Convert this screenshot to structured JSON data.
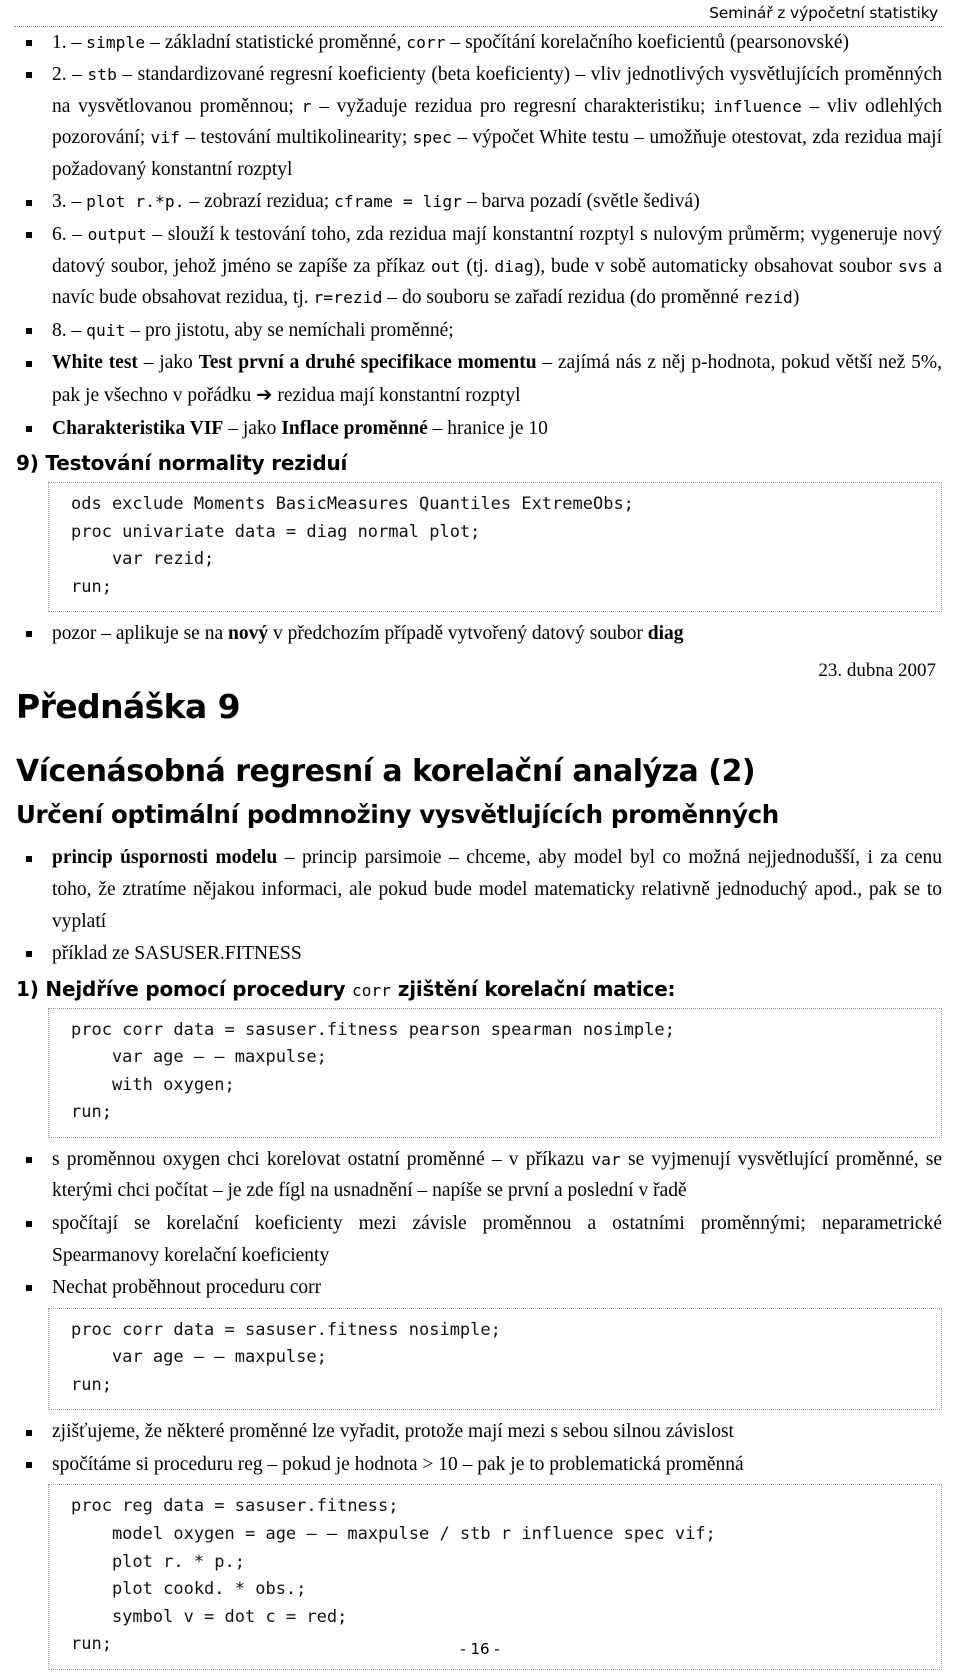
{
  "header": {
    "title": "Seminář z výpočetní statistiky"
  },
  "bullets_top": [
    {
      "id": "item-1-simple",
      "parts": [
        {
          "t": "1. – ",
          "s": "plain"
        },
        {
          "t": "simple",
          "s": "mono"
        },
        {
          "t": " – základní statistické proměnné, ",
          "s": "plain"
        },
        {
          "t": "corr",
          "s": "mono"
        },
        {
          "t": " – spočítání korelačního koeficientů (pearsonovské)",
          "s": "plain"
        }
      ]
    },
    {
      "id": "item-2-stb",
      "parts": [
        {
          "t": "2. – ",
          "s": "plain"
        },
        {
          "t": "stb",
          "s": "mono"
        },
        {
          "t": " – standardizované regresní koeficienty (beta koeficienty) – vliv jednotlivých vysvětlujících proměnných na vysvětlovanou proměnnou; ",
          "s": "plain"
        },
        {
          "t": "r",
          "s": "mono"
        },
        {
          "t": " – vyžaduje rezidua pro regresní charakteristiku; ",
          "s": "plain"
        },
        {
          "t": "influence",
          "s": "mono"
        },
        {
          "t": " – vliv odlehlých pozorování; ",
          "s": "plain"
        },
        {
          "t": "vif",
          "s": "mono"
        },
        {
          "t": " – testování multikolinearity; ",
          "s": "plain"
        },
        {
          "t": "spec",
          "s": "mono"
        },
        {
          "t": " – výpočet White testu – umožňuje otestovat, zda rezidua mají požadovaný konstantní rozptyl",
          "s": "plain"
        }
      ]
    },
    {
      "id": "item-3-plot",
      "parts": [
        {
          "t": "3. – ",
          "s": "plain"
        },
        {
          "t": "plot r.*p.",
          "s": "mono"
        },
        {
          "t": " – zobrazí rezidua; ",
          "s": "plain"
        },
        {
          "t": "cframe = ligr",
          "s": "mono"
        },
        {
          "t": " – barva pozadí (světle šedivá)",
          "s": "plain"
        }
      ]
    },
    {
      "id": "item-6-output",
      "parts": [
        {
          "t": "6. – ",
          "s": "plain"
        },
        {
          "t": "output",
          "s": "mono"
        },
        {
          "t": " – slouží k testování toho, zda rezidua mají konstantní rozptyl s nulovým průměrm; vygeneruje nový datový soubor, jehož jméno se zapíše za příkaz ",
          "s": "plain"
        },
        {
          "t": "out",
          "s": "mono"
        },
        {
          "t": " (tj. ",
          "s": "plain"
        },
        {
          "t": "diag",
          "s": "mono"
        },
        {
          "t": "), bude v sobě automaticky obsahovat soubor ",
          "s": "plain"
        },
        {
          "t": "svs",
          "s": "mono"
        },
        {
          "t": " a navíc bude obsahovat rezidua, tj. ",
          "s": "plain"
        },
        {
          "t": "r=rezid",
          "s": "mono"
        },
        {
          "t": " – do souboru se zařadí rezidua (do proměnné ",
          "s": "plain"
        },
        {
          "t": "rezid",
          "s": "mono"
        },
        {
          "t": ")",
          "s": "plain"
        }
      ]
    },
    {
      "id": "item-8-quit",
      "parts": [
        {
          "t": "8. – ",
          "s": "plain"
        },
        {
          "t": "quit",
          "s": "mono"
        },
        {
          "t": " – pro jistotu, aby se nemíchali proměnné;",
          "s": "plain"
        }
      ]
    },
    {
      "id": "item-white-test",
      "parts": [
        {
          "t": "White test",
          "s": "bold"
        },
        {
          "t": " – jako ",
          "s": "plain"
        },
        {
          "t": "Test první a druhé specifikace momentu",
          "s": "bold"
        },
        {
          "t": " – zajímá nás z něj p-hodnota, pokud větší než 5%, pak je všechno v pořádku ",
          "s": "plain"
        },
        {
          "t": "➔",
          "s": "arrow"
        },
        {
          "t": " rezidua mají konstantní rozptyl",
          "s": "plain"
        }
      ]
    },
    {
      "id": "item-vif",
      "parts": [
        {
          "t": "Charakteristika VIF",
          "s": "bold"
        },
        {
          "t": " – jako ",
          "s": "plain"
        },
        {
          "t": "Inflace proměnné",
          "s": "bold"
        },
        {
          "t": " – hranice je 10",
          "s": "plain"
        }
      ]
    }
  ],
  "section_9": {
    "heading_parts": [
      {
        "t": "9) Testování normality reziduí",
        "s": "plain"
      }
    ],
    "code": [
      "ods exclude Moments BasicMeasures Quantiles ExtremeObs;",
      "proc univariate data = diag normal plot;",
      "    var rezid;",
      "run;"
    ]
  },
  "bullet_pozor": {
    "id": "item-pozor",
    "parts": [
      {
        "t": "pozor – aplikuje se na ",
        "s": "plain"
      },
      {
        "t": "nový",
        "s": "bold"
      },
      {
        "t": " v předchozím případě vytvořený datový soubor ",
        "s": "plain"
      },
      {
        "t": "diag",
        "s": "bold"
      }
    ]
  },
  "date": "23. dubna 2007",
  "lecture_title": "Přednáška 9",
  "big_title": "Vícenásobná regresní a korelační analýza (2)",
  "sub_title": "Určení optimální podmnožiny vysvětlujících proměnných",
  "bullets_mid": [
    {
      "id": "item-princip",
      "parts": [
        {
          "t": "princip úspornosti modelu",
          "s": "bold"
        },
        {
          "t": " – princip parsimoie – chceme, aby model byl co možná nejjednodušší, i za cenu toho, že ztratíme nějakou informaci, ale pokud bude model matematicky relativně jednoduchý apod., pak se to vyplatí",
          "s": "plain"
        }
      ]
    },
    {
      "id": "item-priklad",
      "parts": [
        {
          "t": "příklad ze SASUSER.FITNESS",
          "s": "plain"
        }
      ]
    }
  ],
  "section_1": {
    "heading_parts": [
      {
        "t": "1) Nejdříve pomocí procedury ",
        "s": "plain"
      },
      {
        "t": "corr",
        "s": "mono"
      },
      {
        "t": " zjištění korelační matice:",
        "s": "plain"
      }
    ],
    "code": [
      "proc corr data = sasuser.fitness pearson spearman nosimple;",
      "    var age – – maxpulse;",
      "    with oxygen;",
      "run;"
    ]
  },
  "bullets_after_1": [
    {
      "id": "item-oxygen",
      "parts": [
        {
          "t": "s proměnnou oxygen chci korelovat ostatní proměnné – v příkazu ",
          "s": "plain"
        },
        {
          "t": "var",
          "s": "mono"
        },
        {
          "t": " se vyjmenují vysvětlující proměnné, se kterými chci počítat – je zde fígl na usnadnění – napíše se první a poslední v řadě",
          "s": "plain"
        }
      ]
    },
    {
      "id": "item-spearman",
      "parts": [
        {
          "t": "spočítají se korelační koeficienty mezi závisle proměnnou a ostatními proměnnými; neparametrické Spearmanovy korelační koeficienty",
          "s": "plain"
        }
      ]
    },
    {
      "id": "item-nechat",
      "parts": [
        {
          "t": "Nechat proběhnout proceduru corr",
          "s": "plain"
        }
      ]
    }
  ],
  "code_block_2": [
    "proc corr data = sasuser.fitness nosimple;",
    "    var age – – maxpulse;",
    "run;"
  ],
  "bullets_after_2": [
    {
      "id": "item-zjistujeme",
      "parts": [
        {
          "t": "zjišťujeme, že některé proměnné lze vyřadit, protože mají mezi s sebou silnou závislost",
          "s": "plain"
        }
      ]
    },
    {
      "id": "item-spocitame",
      "parts": [
        {
          "t": "spočítáme si proceduru reg – pokud je hodnota > 10 – pak je to problematická proměnná",
          "s": "plain"
        }
      ]
    }
  ],
  "code_block_3": [
    "proc reg data = sasuser.fitness;",
    "    model oxygen = age – – maxpulse / stb r influence spec vif;",
    "    plot r. * p.;",
    "    plot cookd. * obs.;",
    "    symbol v = dot c = red;",
    "run;"
  ],
  "footer": {
    "page_number": "- 16 -"
  }
}
